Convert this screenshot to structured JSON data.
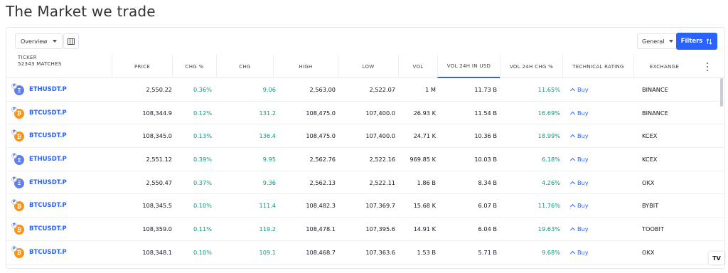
{
  "page": {
    "title": "The Market we trade"
  },
  "toolbar": {
    "view_label": "Overview",
    "general_label": "General",
    "filters_label": "Filters"
  },
  "columns": [
    {
      "label": "Ticker",
      "sub": "52343 MATCHES"
    },
    {
      "label": "Price"
    },
    {
      "label": "Chg %"
    },
    {
      "label": "Chg"
    },
    {
      "label": "High"
    },
    {
      "label": "Low"
    },
    {
      "label": "Vol"
    },
    {
      "label": "Vol 24H in USD"
    },
    {
      "label": "Vol 24H Chg %"
    },
    {
      "label": "Technical Rating"
    },
    {
      "label": "Exchange"
    }
  ],
  "rows": [
    {
      "coin": "eth",
      "symbol": "ETHUSDT.P",
      "price": "2,550.22",
      "chg_pct": "0.36%",
      "chg": "9.06",
      "high": "2,563.00",
      "low": "2,522.07",
      "vol": "1 M",
      "vol_usd": "11.73 B",
      "vol_chg": "11.65%",
      "rating": "Buy",
      "exchange": "BINANCE"
    },
    {
      "coin": "btc",
      "symbol": "BTCUSDT.P",
      "price": "108,344.9",
      "chg_pct": "0.12%",
      "chg": "131.2",
      "high": "108,475.0",
      "low": "107,400.0",
      "vol": "26.93 K",
      "vol_usd": "11.54 B",
      "vol_chg": "16.69%",
      "rating": "Buy",
      "exchange": "BINANCE"
    },
    {
      "coin": "btc",
      "symbol": "BTCUSDT.P",
      "price": "108,345.0",
      "chg_pct": "0.13%",
      "chg": "136.4",
      "high": "108,475.0",
      "low": "107,400.0",
      "vol": "24.71 K",
      "vol_usd": "10.36 B",
      "vol_chg": "18.99%",
      "rating": "Buy",
      "exchange": "KCEX"
    },
    {
      "coin": "eth",
      "symbol": "ETHUSDT.P",
      "price": "2,551.12",
      "chg_pct": "0.39%",
      "chg": "9.95",
      "high": "2,562.76",
      "low": "2,522.16",
      "vol": "969.85 K",
      "vol_usd": "10.03 B",
      "vol_chg": "6.18%",
      "rating": "Buy",
      "exchange": "KCEX"
    },
    {
      "coin": "eth",
      "symbol": "ETHUSDT.P",
      "price": "2,550.47",
      "chg_pct": "0.37%",
      "chg": "9.36",
      "high": "2,562.13",
      "low": "2,522.11",
      "vol": "1.86 B",
      "vol_usd": "8.34 B",
      "vol_chg": "4.26%",
      "rating": "Buy",
      "exchange": "OKX"
    },
    {
      "coin": "btc",
      "symbol": "BTCUSDT.P",
      "price": "108,345.5",
      "chg_pct": "0.10%",
      "chg": "111.4",
      "high": "108,482.3",
      "low": "107,369.7",
      "vol": "15.68 K",
      "vol_usd": "6.07 B",
      "vol_chg": "11.76%",
      "rating": "Buy",
      "exchange": "BYBIT"
    },
    {
      "coin": "btc",
      "symbol": "BTCUSDT.P",
      "price": "108,359.0",
      "chg_pct": "0.11%",
      "chg": "119.2",
      "high": "108,478.1",
      "low": "107,395.6",
      "vol": "14.91 K",
      "vol_usd": "6.04 B",
      "vol_chg": "19.63%",
      "rating": "Buy",
      "exchange": "TOOBIT"
    },
    {
      "coin": "btc",
      "symbol": "BTCUSDT.P",
      "price": "108,348.1",
      "chg_pct": "0.10%",
      "chg": "109.1",
      "high": "108,468.7",
      "low": "107,363.6",
      "vol": "1.53 B",
      "vol_usd": "5.71 B",
      "vol_chg": "9.68%",
      "rating": "Buy",
      "exchange": "OKX"
    }
  ],
  "colors": {
    "accent": "#2962ff",
    "positive": "#089981"
  },
  "branding": {
    "logo_text": "TV"
  }
}
